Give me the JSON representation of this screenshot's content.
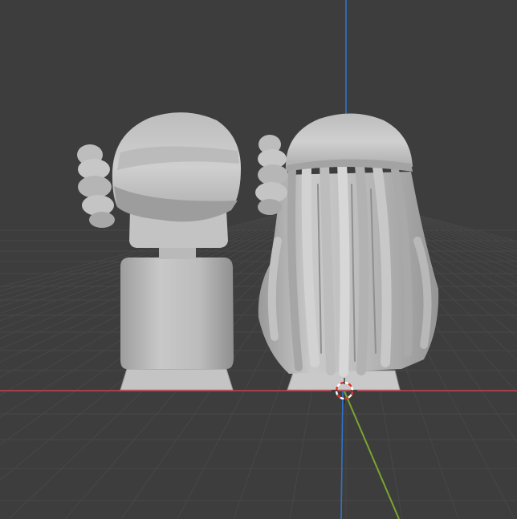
{
  "app": {
    "name": "3D Viewport"
  },
  "colors": {
    "background": "#3d3d3d",
    "grid_minor": "#474747",
    "grid_major": "#4c4c4c",
    "axis_x": "#c5424f",
    "axis_y": "#7aa531",
    "axis_z": "#2f73c9",
    "clay_light": "#cfcfcf",
    "clay_mid": "#b3b3b3",
    "clay_dark": "#8e8e8e",
    "cursor_red": "#d8302b",
    "cursor_white": "#ffffff"
  },
  "scene": {
    "objects": [
      {
        "name": "bun-hair-bust"
      },
      {
        "name": "long-hair-bust"
      }
    ],
    "cursor": "3d-cursor-icon"
  }
}
